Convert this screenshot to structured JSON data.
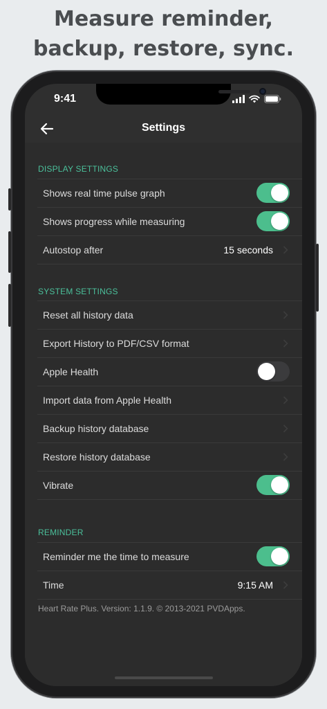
{
  "headline": {
    "line1": "Measure reminder,",
    "line2": "backup, restore, sync."
  },
  "status_bar": {
    "time": "9:41",
    "icons": [
      "signal-icon",
      "wifi-icon",
      "battery-icon"
    ]
  },
  "nav": {
    "title": "Settings",
    "back_icon": "arrow-left-icon"
  },
  "colors": {
    "accent": "#4bc09b",
    "toggle_on": "#4cbe8d",
    "background": "#2c2c2c"
  },
  "display_settings": {
    "header": "DISPLAY SETTINGS",
    "rows": [
      {
        "label": "Shows real time pulse graph",
        "toggle": "on"
      },
      {
        "label": "Shows progress while measuring",
        "toggle": "on"
      },
      {
        "label": "Autostop after",
        "value": "15 seconds"
      }
    ]
  },
  "system_settings": {
    "header": "SYSTEM SETTINGS",
    "rows": [
      {
        "label": "Reset all history data"
      },
      {
        "label": "Export History to PDF/CSV format"
      },
      {
        "label": "Apple Health",
        "toggle": "off"
      },
      {
        "label": "Import data from Apple Health"
      },
      {
        "label": "Backup history database"
      },
      {
        "label": "Restore history database"
      },
      {
        "label": "Vibrate",
        "toggle": "on"
      }
    ]
  },
  "reminder": {
    "header": "REMINDER",
    "rows": [
      {
        "label": "Reminder me the time to measure",
        "toggle": "on"
      },
      {
        "label": "Time",
        "value": "9:15 AM"
      }
    ]
  },
  "footer": "Heart Rate Plus. Version: 1.1.9. © 2013-2021 PVDApps."
}
